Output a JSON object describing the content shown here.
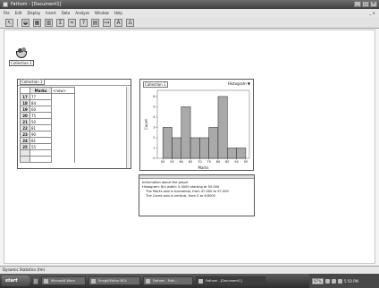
{
  "window": {
    "title": "Fathom - [Document1]",
    "controls": {
      "minimize": "_",
      "maximize": "□",
      "close": "×"
    }
  },
  "menu": {
    "items": [
      "File",
      "Edit",
      "Display",
      "Insert",
      "Data",
      "Analyze",
      "Window",
      "Help"
    ],
    "doc_controls": "_ ×"
  },
  "toolbar": {
    "buttons": [
      "pointer-tool",
      "collection-tool",
      "table-tool",
      "graph-tool",
      "summary-tool",
      "estimate-tool",
      "test-tool",
      "model-tool",
      "slider-tool",
      "text-tool",
      "person-tool"
    ]
  },
  "collection": {
    "label": "Collection 1"
  },
  "case_table": {
    "title": "Collection 1",
    "attribute": "Marks",
    "new_column": "<new>",
    "rows": [
      {
        "n": "17",
        "v": "77"
      },
      {
        "n": "18",
        "v": "84"
      },
      {
        "n": "19",
        "v": "60"
      },
      {
        "n": "20",
        "v": "75"
      },
      {
        "n": "21",
        "v": "50"
      },
      {
        "n": "22",
        "v": "81"
      },
      {
        "n": "23",
        "v": "90"
      },
      {
        "n": "24",
        "v": "81"
      },
      {
        "n": "25",
        "v": "55"
      }
    ]
  },
  "graph": {
    "title": "Collection 1",
    "type_label": "Histogram ▼"
  },
  "chart_data": {
    "type": "bar",
    "title": "",
    "xlabel": "Marks",
    "ylabel": "Count",
    "bin_start": 50,
    "bin_width": 5,
    "values": [
      3,
      2,
      5,
      2,
      2,
      3,
      6,
      1,
      1
    ],
    "xticks": [
      50,
      55,
      60,
      65,
      70,
      75,
      80,
      85,
      90,
      95
    ],
    "yticks": [
      0,
      1,
      2,
      3,
      4,
      5,
      6
    ],
    "xlim": [
      47,
      97
    ],
    "ylim": [
      0,
      6.6
    ],
    "bar_color": "#a9a9a9"
  },
  "info": {
    "lines": [
      "Information about the graph:",
      "Histogram: Bin width: 5.0000 starting at 50.000",
      "The Marks axis is horizontal, from 47.000 to 97.000",
      "The Count axis is vertical, from 0 to 6.6000"
    ]
  },
  "status": {
    "text": "Dynamic Statistics (tm)"
  },
  "taskbar": {
    "start": "start",
    "tasks": [
      {
        "label": "Microsoft Word",
        "active": false
      },
      {
        "label": "SnagIt/Editor BC4",
        "active": false
      },
      {
        "label": "Fathom - Fath...",
        "active": false
      },
      {
        "label": "Fathom - [Document1]",
        "active": true
      }
    ],
    "battery": "97%",
    "clock": "5:50 PM"
  },
  "colors": {
    "bars": "#a9a9a9",
    "taskbar": "#3f3f3f"
  }
}
